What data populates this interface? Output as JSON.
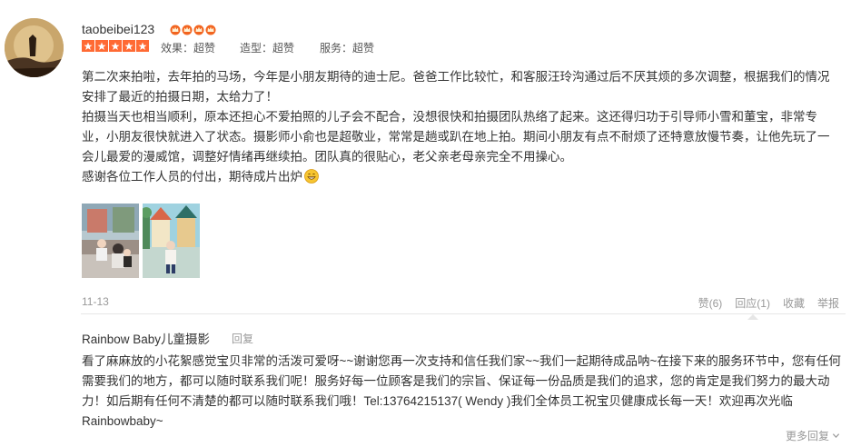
{
  "review": {
    "username": "taobeibei123",
    "crown_icon": "crown-icon",
    "crown_count": 4,
    "star_rating": 5,
    "ratings": [
      {
        "label": "效果：超赞"
      },
      {
        "label": "造型：超赞"
      },
      {
        "label": "服务：超赞"
      }
    ],
    "paragraphs": [
      "第二次来拍啦，去年拍的马场，今年是小朋友期待的迪士尼。爸爸工作比较忙，和客服汪玲沟通过后不厌其烦的多次调整，根据我们的情况安排了最近的拍摄日期，太给力了！",
      "拍摄当天也相当顺利，原本还担心不爱拍照的儿子会不配合，没想很快和拍摄团队热络了起来。这还得归功于引导师小雪和董宝，非常专业，小朋友很快就进入了状态。摄影师小俞也是超敬业，常常是趟或趴在地上拍。期间小朋友有点不耐烦了还特意放慢节奏，让他先玩了一会儿最爱的漫威馆，调整好情绪再继续拍。团队真的很贴心，老父亲老母亲完全不用操心。",
      "感谢各位工作人员的付出，期待成片出炉"
    ],
    "emoji_icon": "grin-emoji-icon",
    "photos": [
      {
        "name": "photo-1"
      },
      {
        "name": "photo-2"
      }
    ],
    "date": "11-13",
    "actions": {
      "like": "赞(6)",
      "reply": "回应(1)",
      "favorite": "收藏",
      "report": "举报"
    }
  },
  "reply": {
    "merchant": "Rainbow Baby儿童摄影",
    "tag": "回复",
    "text": "看了麻麻放的小花絮感觉宝贝非常的活泼可爱呀~~谢谢您再一次支持和信任我们家~~我们一起期待成品呐~在接下来的服务环节中，您有任何需要我们的地方，都可以随时联系我们呢！服务好每一位顾客是我们的宗旨、保证每一份品质是我们的追求，您的肯定是我们努力的最大动力！如后期有任何不清楚的都可以随时联系我们哦！Tel:13764215137( Wendy )我们全体员工祝宝贝健康成长每一天！欢迎再次光临Rainbowbaby~"
  },
  "footer": {
    "more_replies": "更多回复",
    "chevron_icon": "chevron-down-icon"
  },
  "colors": {
    "star": "#ff6a34",
    "crown": "#f2641f",
    "muted_text": "#999999",
    "body_text": "#333333",
    "divider": "#e6e6e6"
  }
}
